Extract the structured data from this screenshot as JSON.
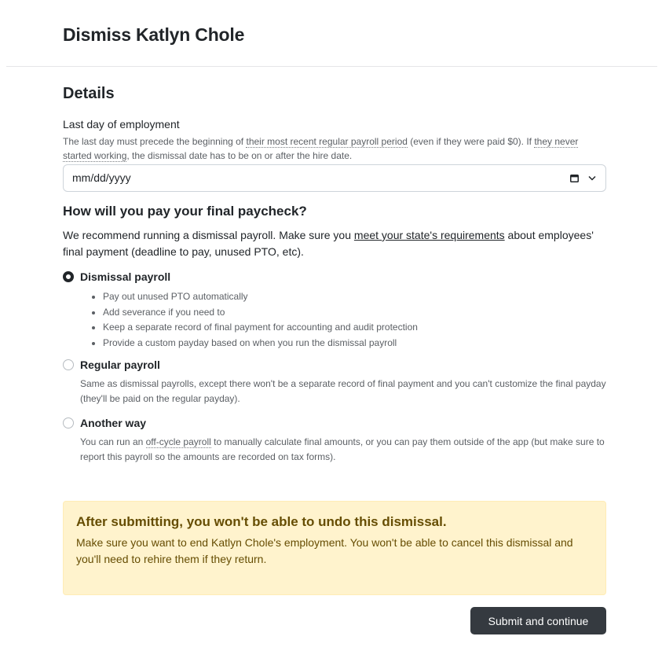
{
  "header": {
    "title": "Dismiss Katlyn Chole"
  },
  "details": {
    "title": "Details",
    "last_day": {
      "label": "Last day of employment",
      "hint_part1": "The last day must precede the beginning of ",
      "hint_link1": "their most recent regular payroll period",
      "hint_part2": " (even if they were paid $0). If ",
      "hint_link2": "they never started working",
      "hint_part3": ", the dismissal date has to be on or after the hire date.",
      "placeholder": "mm/dd/yyyy"
    }
  },
  "final_paycheck": {
    "title": "How will you pay your final paycheck?",
    "intro_part1": "We recommend running a dismissal payroll. Make sure you ",
    "intro_link": "meet your state's requirements",
    "intro_part2": " about employees' final payment (deadline to pay, unused PTO, etc).",
    "options": [
      {
        "label": "Dismissal payroll",
        "selected": true,
        "bullets": [
          "Pay out unused PTO automatically",
          "Add severance if you need to",
          "Keep a separate record of final payment for accounting and audit protection",
          "Provide a custom payday based on when you run the dismissal payroll"
        ]
      },
      {
        "label": "Regular payroll",
        "selected": false,
        "description": "Same as dismissal payrolls, except there won't be a separate record of final payment and you can't customize the final payday (they'll be paid on the regular payday)."
      },
      {
        "label": "Another way",
        "selected": false,
        "desc_part1": "You can run an ",
        "desc_link": "off-cycle payroll",
        "desc_part2": " to manually calculate final amounts, or you can pay them outside of the app (but make sure to report this payroll so the amounts are recorded on tax forms)."
      }
    ]
  },
  "alert": {
    "title": "After submitting, you won't be able to undo this dismissal.",
    "body": "Make sure you want to end Katlyn Chole's employment. You won't be able to cancel this dismissal and you'll need to rehire them if they return."
  },
  "actions": {
    "submit_label": "Submit and continue"
  },
  "colors": {
    "primary_button": "#353a40",
    "alert_background": "#fff3cd",
    "alert_text": "#664d03"
  }
}
